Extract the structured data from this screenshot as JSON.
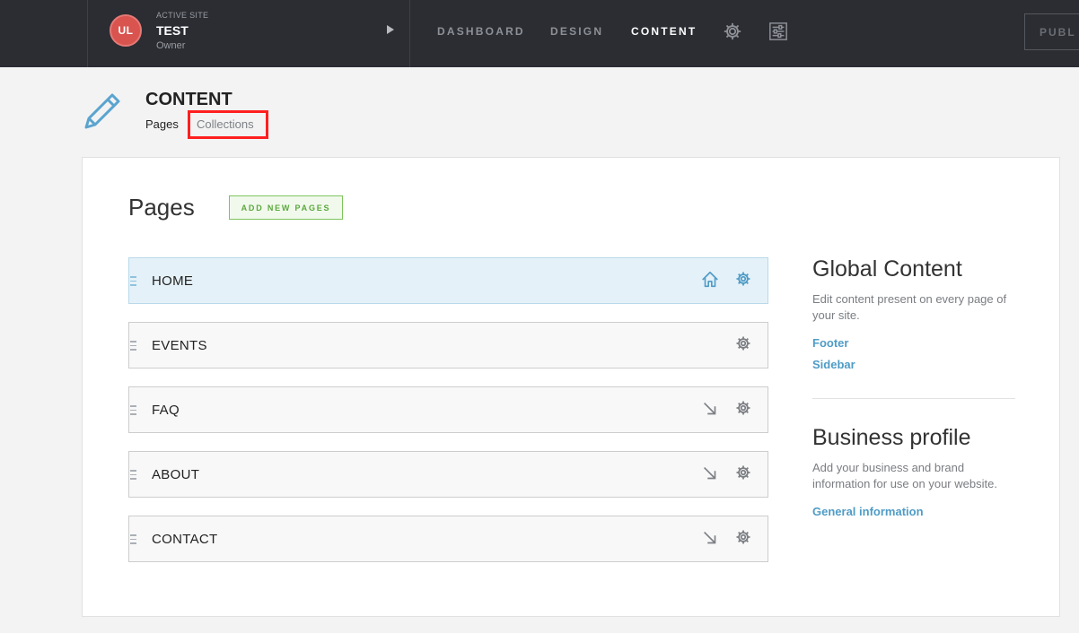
{
  "topbar": {
    "site": {
      "avatar_initials": "UL",
      "kicker": "ACTIVE SITE",
      "name": "TEST",
      "role": "Owner"
    },
    "nav": [
      {
        "label": "DASHBOARD",
        "active": false
      },
      {
        "label": "DESIGN",
        "active": false
      },
      {
        "label": "CONTENT",
        "active": true
      }
    ],
    "icons": [
      "gear-icon",
      "sliders-icon"
    ],
    "publish_label": "PUBL"
  },
  "header": {
    "title": "CONTENT",
    "subnav": {
      "pages": "Pages",
      "collections": "Collections"
    }
  },
  "pages": {
    "heading": "Pages",
    "add_button": "ADD NEW PAGES",
    "rows": [
      {
        "label": "HOME",
        "icon": "home-icon"
      },
      {
        "label": "EVENTS",
        "icon": ""
      },
      {
        "label": "FAQ",
        "icon": "arrow-down-right-icon"
      },
      {
        "label": "ABOUT",
        "icon": "arrow-down-right-icon"
      },
      {
        "label": "CONTACT",
        "icon": "arrow-down-right-icon"
      }
    ]
  },
  "global_content": {
    "title": "Global Content",
    "description": "Edit content present on every page of your site.",
    "links": [
      "Footer",
      "Sidebar"
    ]
  },
  "business_profile": {
    "title": "Business profile",
    "description": "Add your business and brand information for use on your website.",
    "link": "General information"
  },
  "colors": {
    "topbar": "#2b2d33",
    "accent_link": "#4f9cc6",
    "add_button": "#5aa83b",
    "highlight_box": "#ff1f1f"
  }
}
